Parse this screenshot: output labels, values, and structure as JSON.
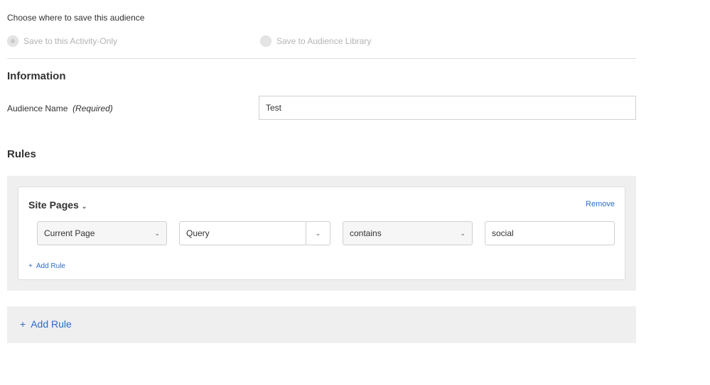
{
  "save": {
    "prompt": "Choose where to save this audience",
    "options": [
      {
        "label": "Save to this Activity-Only",
        "selected": true
      },
      {
        "label": "Save to Audience Library",
        "selected": false
      }
    ]
  },
  "information": {
    "heading": "Information",
    "name_label": "Audience Name",
    "required": "(Required)",
    "name_value": "Test"
  },
  "rules": {
    "heading": "Rules",
    "group": {
      "title": "Site Pages",
      "remove": "Remove",
      "field1": "Current Page",
      "field2": "Query",
      "operator": "contains",
      "value": "social",
      "add_rule": "Add Rule"
    },
    "add_rule": "Add Rule"
  },
  "icons": {
    "plus": "+",
    "chevron": "⌄"
  }
}
